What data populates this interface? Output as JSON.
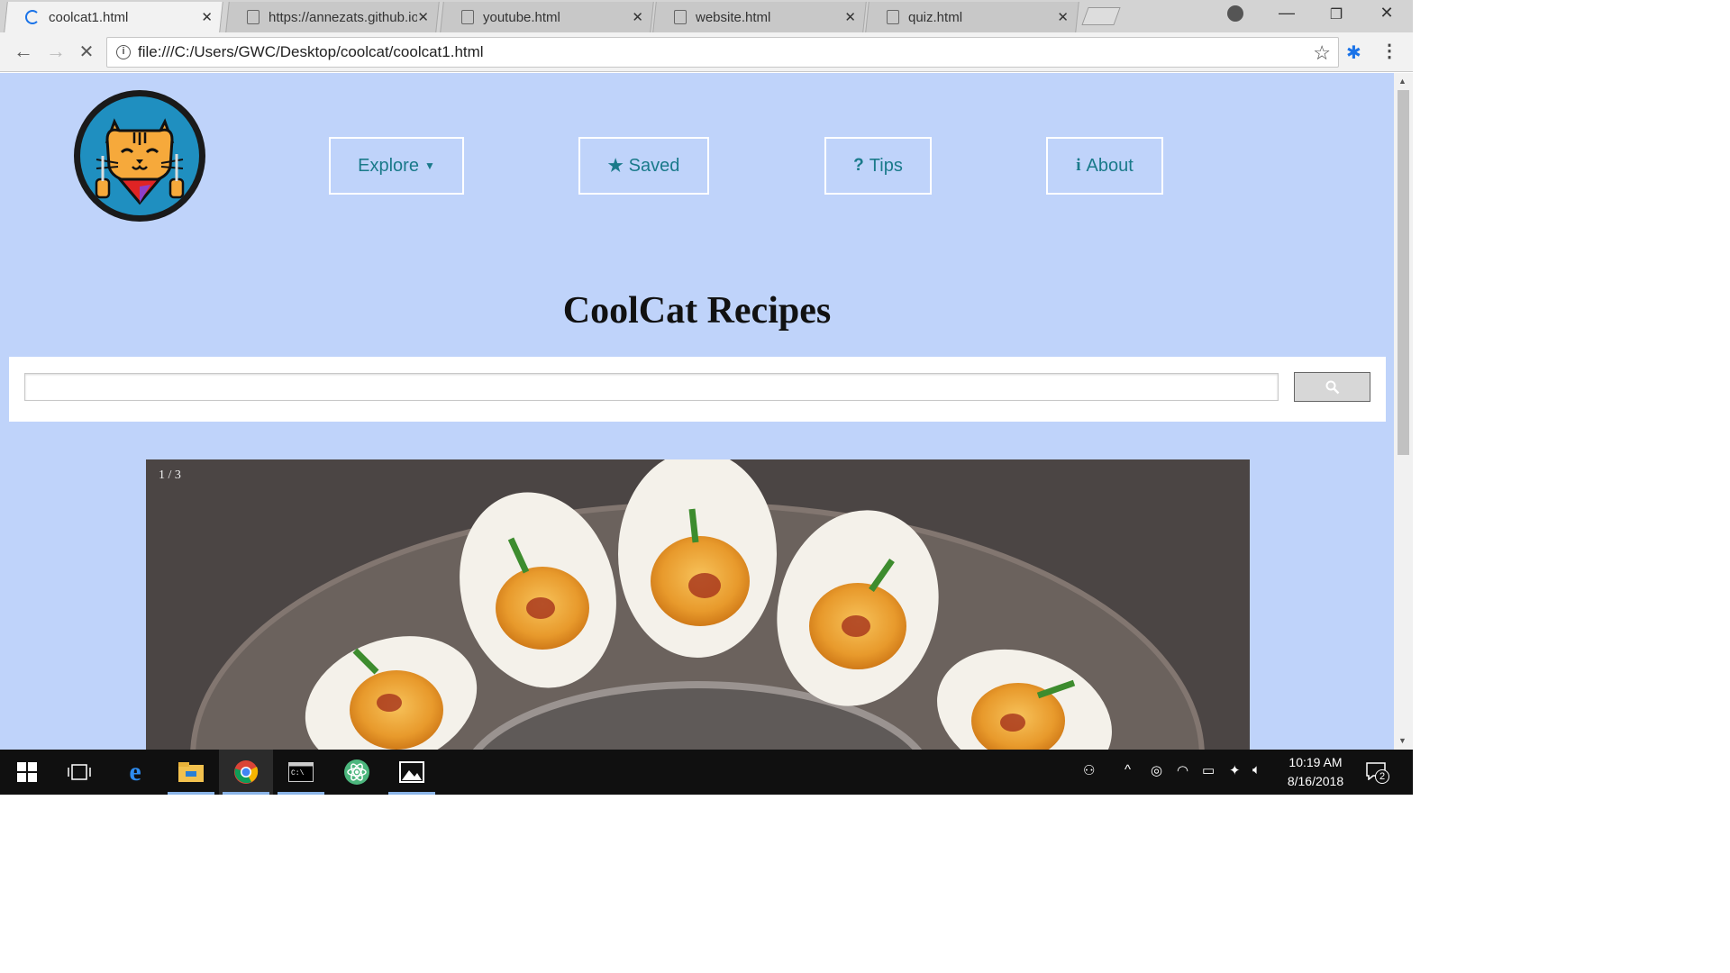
{
  "browser": {
    "tabs": [
      {
        "title": "coolcat1.html",
        "active": true,
        "loading": true
      },
      {
        "title": "https://annezats.github.io",
        "active": false
      },
      {
        "title": "youtube.html",
        "active": false
      },
      {
        "title": "website.html",
        "active": false
      },
      {
        "title": "quiz.html",
        "active": false
      }
    ],
    "url": "file:///C:/Users/GWC/Desktop/coolcat/coolcat1.html"
  },
  "page": {
    "nav": {
      "explore": "Explore",
      "saved": "Saved",
      "tips": "Tips",
      "about": "About"
    },
    "title": "CoolCat Recipes",
    "search": {
      "value": ""
    },
    "slideshow": {
      "counter": "1 / 3"
    },
    "colors": {
      "background": "#bfd3fa",
      "nav_text": "#1a7a8a",
      "logo_circle": "#1f8fc0"
    }
  },
  "taskbar": {
    "clock_time": "10:19 AM",
    "clock_date": "8/16/2018",
    "notification_count": "2"
  }
}
